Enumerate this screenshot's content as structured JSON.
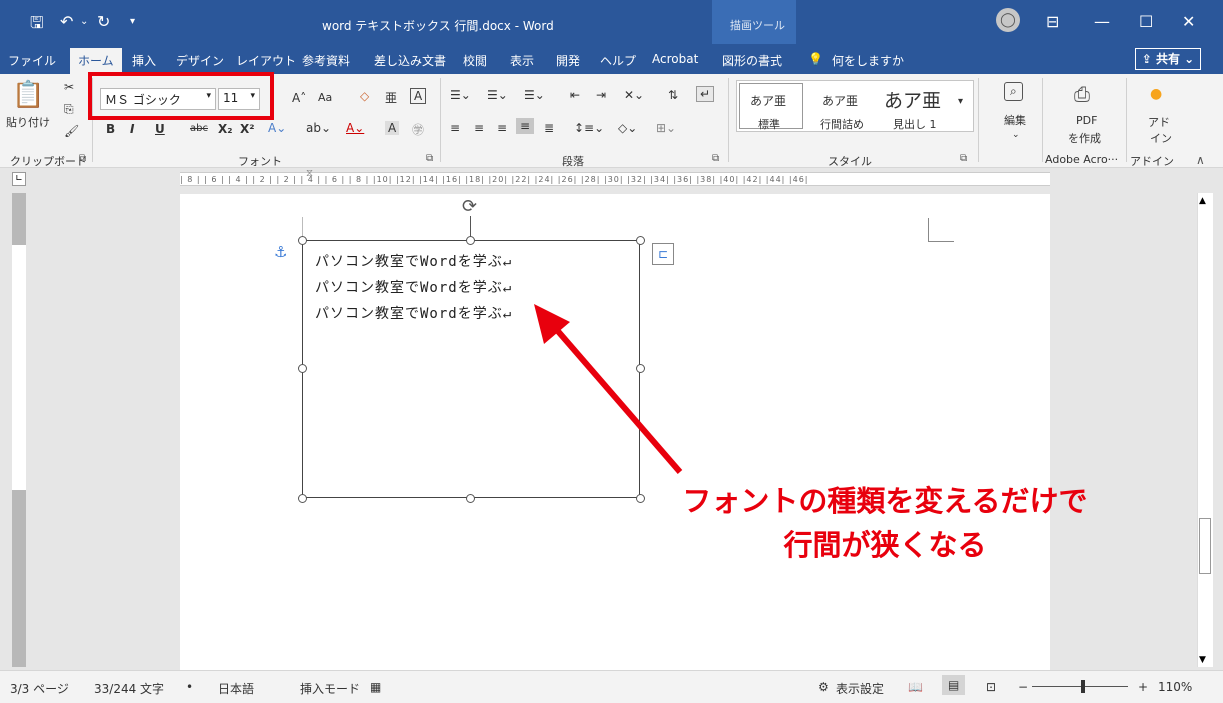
{
  "titlebar": {
    "doc_title": "word テキストボックス 行間.docx  -  Word",
    "tool_context": "描画ツール"
  },
  "tabs": [
    "ファイル",
    "ホーム",
    "挿入",
    "デザイン",
    "レイアウト",
    "参考資料",
    "差し込み文書",
    "校閲",
    "表示",
    "開発",
    "ヘルプ",
    "Acrobat",
    "図形の書式"
  ],
  "tell_me": "何をしますか",
  "share": "共有",
  "ribbon": {
    "clipboard": {
      "paste": "貼り付け",
      "label": "クリップボード"
    },
    "font": {
      "name": "ＭＳ ゴシック",
      "size": "11",
      "label": "フォント",
      "aa": "Aa",
      "bold": "B",
      "italic": "I",
      "underline": "U",
      "strike": "abc"
    },
    "paragraph": {
      "label": "段落"
    },
    "styles": {
      "s1_sample": "あア亜",
      "s1_name": "標準",
      "s2_sample": "あア亜",
      "s2_name": "行間詰め",
      "s3_sample": "あア亜",
      "s3_name": "見出し 1",
      "label": "スタイル"
    },
    "edit": {
      "label": "編集"
    },
    "pdf": {
      "line1": "PDF",
      "line2": "を作成",
      "label": "Adobe Acro···"
    },
    "addin": {
      "line1": "アド",
      "line2": "イン",
      "label": "アドイン"
    }
  },
  "ruler_text": "| 8 |  | 6 |  | 4 |  | 2 |    | 2 |  | 4 |  | 6 |  | 8 |  |10|  |12|  |14|  |16|  |18|  |20|  |22|  |24|  |26|  |28|  |30|  |32|  |34|  |36|  |38|  |40|  |42|  |44|  |46|",
  "textbox_lines": [
    "パソコン教室でWordを学ぶ↵",
    "パソコン教室でWordを学ぶ↵",
    "パソコン教室でWordを学ぶ↵"
  ],
  "annotation": {
    "line1": "フォントの種類を変えるだけで",
    "line2": "行間が狭くなる"
  },
  "status": {
    "page": "3/3 ページ",
    "words": "33/244 文字",
    "lang": "日本語",
    "mode": "挿入モード",
    "display": "表示設定",
    "zoom": "110%"
  },
  "colors": {
    "titlebar": "#2b579a",
    "highlight": "#e8000d"
  }
}
